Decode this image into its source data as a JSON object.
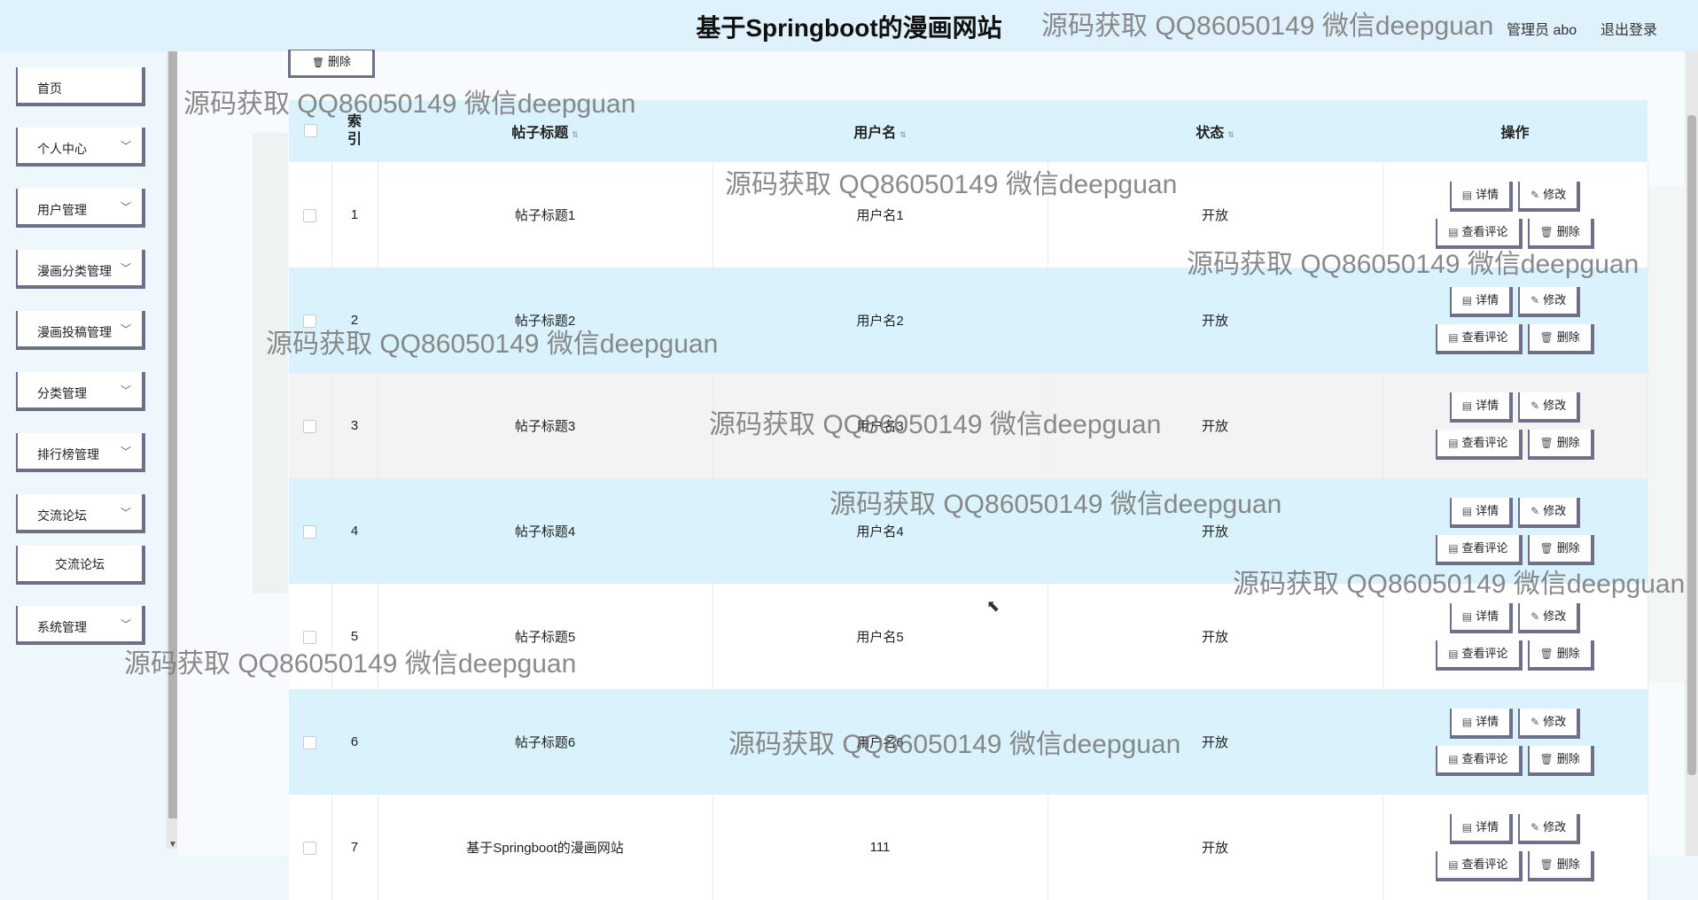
{
  "header": {
    "title": "基于Springboot的漫画网站",
    "user_label": "管理员 abo",
    "logout_label": "退出登录"
  },
  "sidebar": {
    "items": [
      {
        "label": "首页",
        "chevron": ""
      },
      {
        "label": "个人中心",
        "chevron": "﹀"
      },
      {
        "label": "用户管理",
        "chevron": "﹀"
      },
      {
        "label": "漫画分类管理",
        "chevron": "﹀"
      },
      {
        "label": "漫画投稿管理",
        "chevron": "﹀"
      },
      {
        "label": "分类管理",
        "chevron": "﹀"
      },
      {
        "label": "排行榜管理",
        "chevron": "﹀"
      },
      {
        "label": "交流论坛",
        "chevron": "﹀"
      },
      {
        "label": "交流论坛",
        "chevron": ""
      },
      {
        "label": "系统管理",
        "chevron": "﹀"
      }
    ]
  },
  "toolbar": {
    "delete_label": "删除",
    "delete_icon": "🗑"
  },
  "table": {
    "columns": {
      "index": "索引",
      "title": "帖子标题",
      "username": "用户名",
      "status": "状态",
      "actions": "操作",
      "sort_icon": "⇅"
    },
    "buttons": {
      "detail": "详情",
      "edit": "修改",
      "comments": "查看评论",
      "delete": "删除",
      "detail_icon": "▤",
      "edit_icon": "✎",
      "comments_icon": "▤",
      "delete_icon": "🗑"
    },
    "rows": [
      {
        "index": "1",
        "title": "帖子标题1",
        "username": "用户名1",
        "status": "开放"
      },
      {
        "index": "2",
        "title": "帖子标题2",
        "username": "用户名2",
        "status": "开放"
      },
      {
        "index": "3",
        "title": "帖子标题3",
        "username": "用户名3",
        "status": "开放"
      },
      {
        "index": "4",
        "title": "帖子标题4",
        "username": "用户名4",
        "status": "开放"
      },
      {
        "index": "5",
        "title": "帖子标题5",
        "username": "用户名5",
        "status": "开放"
      },
      {
        "index": "6",
        "title": "帖子标题6",
        "username": "用户名6",
        "status": "开放"
      },
      {
        "index": "7",
        "title": "基于Springboot的漫画网站",
        "username": "111",
        "status": "开放"
      }
    ]
  },
  "watermark": "源码获取 QQ86050149 微信deepguan"
}
